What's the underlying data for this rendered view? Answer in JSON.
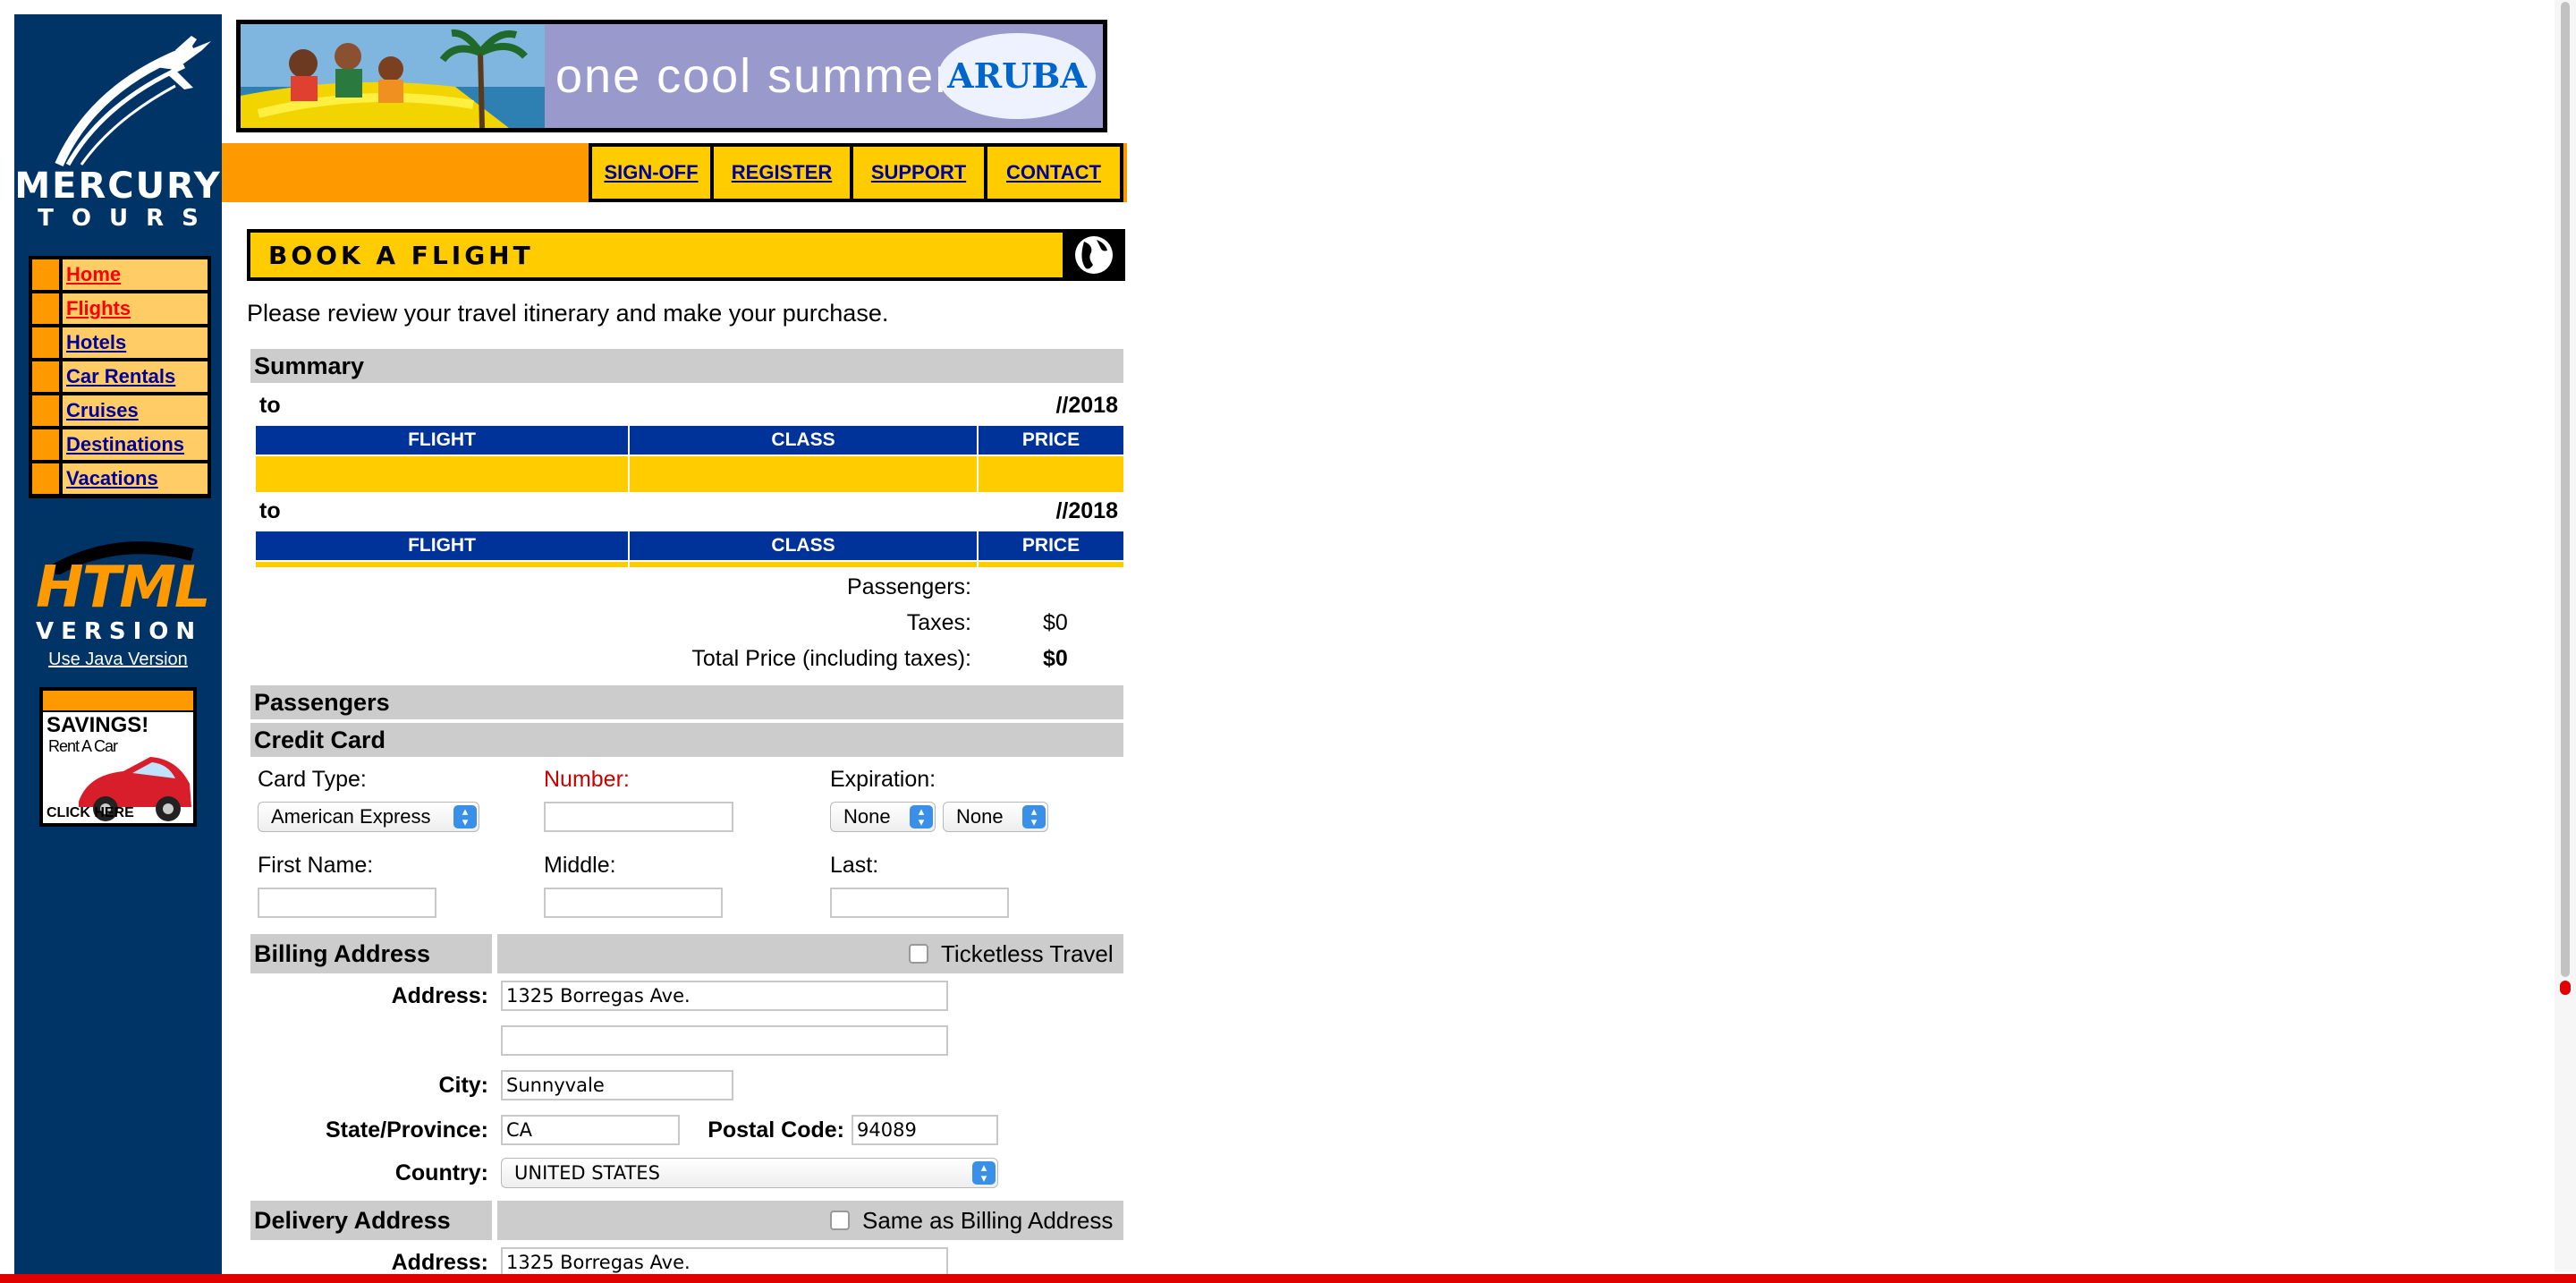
{
  "brand": {
    "name": "MERCURY",
    "sub": "TOURS"
  },
  "banner": {
    "text": "one cool summer",
    "logo": "ARUBA"
  },
  "top_nav": [
    "SIGN-OFF",
    "REGISTER",
    "SUPPORT",
    "CONTACT"
  ],
  "side_nav": [
    {
      "label": "Home",
      "active": true
    },
    {
      "label": "Flights",
      "active": true
    },
    {
      "label": "Hotels",
      "active": false
    },
    {
      "label": "Car Rentals",
      "active": false
    },
    {
      "label": "Cruises",
      "active": false
    },
    {
      "label": "Destinations",
      "active": false
    },
    {
      "label": "Vacations",
      "active": false
    }
  ],
  "html_version": {
    "title": "HTML",
    "sub": "VERSION",
    "java_link": "Use Java Version"
  },
  "savings_ad": {
    "title": "SAVINGS!",
    "sub": "Rent A Car",
    "cta": "CLICK HERE"
  },
  "page": {
    "title": "BOOK A FLIGHT",
    "intro": "Please review your travel itinerary and make your purchase."
  },
  "summary": {
    "heading": "Summary",
    "depart": {
      "route": "to",
      "date": "//2018"
    },
    "return": {
      "route": "to",
      "date": "//2018"
    },
    "columns": [
      "FLIGHT",
      "CLASS",
      "PRICE"
    ],
    "passengers_label": "Passengers:",
    "passengers_value": "",
    "taxes_label": "Taxes:",
    "taxes_value": "$0",
    "total_label": "Total Price (including taxes):",
    "total_value": "$0"
  },
  "passengers": {
    "heading": "Passengers"
  },
  "credit_card": {
    "heading": "Credit Card",
    "card_type_label": "Card Type:",
    "card_type_value": "American Express",
    "number_label": "Number:",
    "number_value": "",
    "expiration_label": "Expiration:",
    "exp_month": "None",
    "exp_year": "None",
    "first_label": "First Name:",
    "middle_label": "Middle:",
    "last_label": "Last:",
    "first_value": "",
    "middle_value": "",
    "last_value": ""
  },
  "billing": {
    "heading": "Billing Address",
    "ticketless_label": "Ticketless Travel",
    "address_label": "Address:",
    "address1": "1325 Borregas Ave.",
    "address2": "",
    "city_label": "City:",
    "city": "Sunnyvale",
    "state_label": "State/Province:",
    "state": "CA",
    "postal_label": "Postal Code:",
    "postal": "94089",
    "country_label": "Country:",
    "country": "UNITED STATES"
  },
  "delivery": {
    "heading": "Delivery Address",
    "same_label": "Same as Billing Address",
    "address_label": "Address:",
    "address1": "1325 Borregas Ave."
  },
  "colors": {
    "sidebar": "#003366",
    "orange": "#ff9900",
    "yellow": "#ffcc00",
    "table_header": "#003399",
    "section_gray": "#cccccc",
    "link": "#000099",
    "active_link": "#ff0000"
  }
}
